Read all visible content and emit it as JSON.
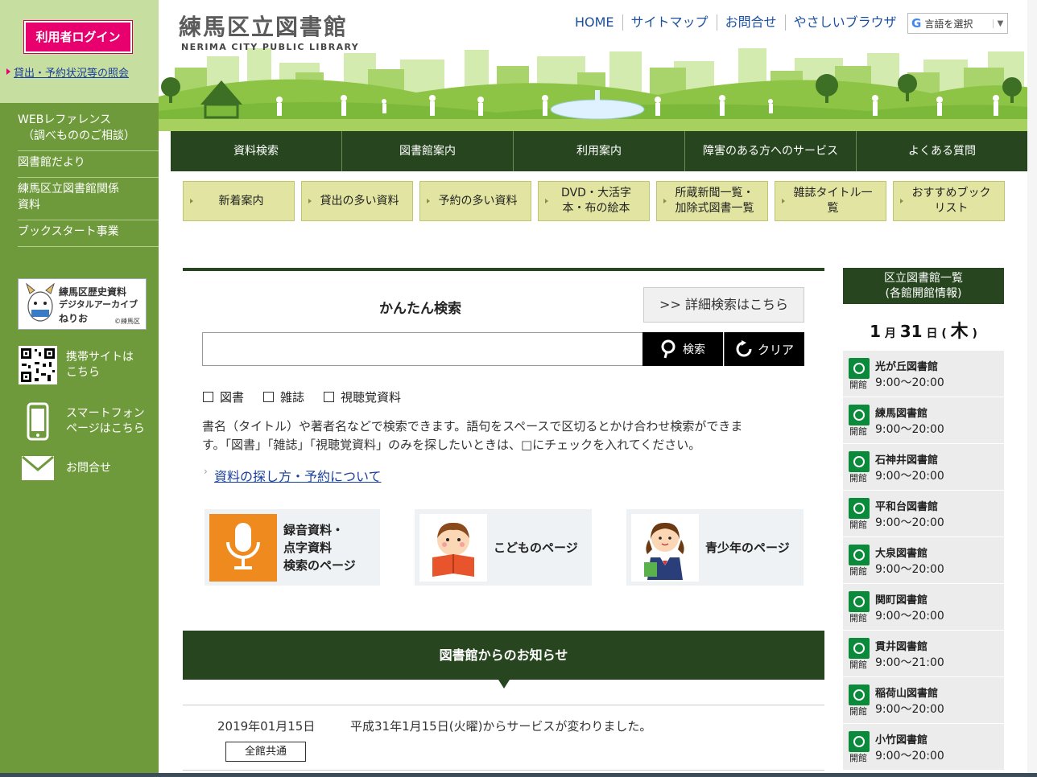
{
  "sidebar": {
    "login_label": "利用者ログイン",
    "lending_link": "貸出・予約状況等の照会",
    "nav": [
      {
        "line1": "WEBレファレンス",
        "line2": "（調べもののご相談）"
      },
      {
        "line1": "図書館だより",
        "line2": ""
      },
      {
        "line1": "練馬区立図書館関係",
        "line2": "資料"
      },
      {
        "line1": "ブックスタート事業",
        "line2": ""
      }
    ],
    "archive": {
      "line1": "練馬区歴史資料",
      "line2": "デジタルアーカイブ",
      "line3": "ねりお",
      "credit": "©練馬区"
    },
    "mobile": {
      "line1": "携帯サイトは",
      "line2": "こちら"
    },
    "smartphone": {
      "line1": "スマートフォン",
      "line2": "ページはこちら"
    },
    "contact": "お問合せ"
  },
  "header": {
    "title": "練馬区立図書館",
    "subtitle": "NERIMA CITY PUBLIC LIBRARY",
    "links": [
      "HOME",
      "サイトマップ",
      "お問合せ",
      "やさしいブラウザ"
    ],
    "lang_select": "言語を選択"
  },
  "main_nav": [
    "資料検索",
    "図書館案内",
    "利用案内",
    "障害のある方へのサービス",
    "よくある質問"
  ],
  "sub_nav": [
    {
      "line1": "新着案内",
      "line2": ""
    },
    {
      "line1": "貸出の多い資料",
      "line2": ""
    },
    {
      "line1": "予約の多い資料",
      "line2": ""
    },
    {
      "line1": "DVD・大活字",
      "line2": "本・布の絵本"
    },
    {
      "line1": "所蔵新聞一覧・",
      "line2": "加除式図書一覧"
    },
    {
      "line1": "雑誌タイトル一",
      "line2": "覧"
    },
    {
      "line1": "おすすめブック",
      "line2": "リスト"
    }
  ],
  "search": {
    "title": "かんたん検索",
    "advanced": ">> 詳細検索はこちら",
    "input_value": "",
    "search_btn": "検索",
    "clear_btn": "クリア",
    "checkboxes": [
      "図書",
      "雑誌",
      "視聴覚資料"
    ],
    "desc1": "書名（タイトル）や著者名などで検索できます。語句をスペースで区切るとかけ合わせ検索ができま",
    "desc2": "す。「図書」「雑誌」「視聴覚資料」のみを探したいときは、□にチェックを入れてください。",
    "howto": "資料の探し方・予約について"
  },
  "features": [
    {
      "line1": "録音資料・",
      "line2": "点字資料",
      "line3": "検索のページ"
    },
    {
      "line1": "こどものページ",
      "line2": "",
      "line3": ""
    },
    {
      "line1": "青少年のページ",
      "line2": "",
      "line3": ""
    }
  ],
  "news": {
    "heading": "図書館からのお知らせ",
    "items": [
      {
        "date": "2019年01月15日",
        "text": "平成31年1月15日(火曜)からサービスが変わりました。",
        "tag": "全館共通"
      }
    ]
  },
  "libraries": {
    "heading1": "区立図書館一覧",
    "heading2": "(各館開館情報)",
    "date": {
      "month": "1",
      "month_suffix": "月",
      "day": "31",
      "day_suffix": "日",
      "open_paren": "(",
      "weekday": "木",
      "close_paren": ")"
    },
    "list": [
      {
        "name": "光が丘図書館",
        "hours": "9:00～20:00",
        "status": "開館"
      },
      {
        "name": "練馬図書館",
        "hours": "9:00～20:00",
        "status": "開館"
      },
      {
        "name": "石神井図書館",
        "hours": "9:00～20:00",
        "status": "開館"
      },
      {
        "name": "平和台図書館",
        "hours": "9:00～20:00",
        "status": "開館"
      },
      {
        "name": "大泉図書館",
        "hours": "9:00～20:00",
        "status": "開館"
      },
      {
        "name": "関町図書館",
        "hours": "9:00～20:00",
        "status": "開館"
      },
      {
        "name": "貫井図書館",
        "hours": "9:00～21:00",
        "status": "開館"
      },
      {
        "name": "稲荷山図書館",
        "hours": "9:00～20:00",
        "status": "開館"
      },
      {
        "name": "小竹図書館",
        "hours": "9:00～20:00",
        "status": "開館"
      }
    ]
  },
  "colors": {
    "dark_green": "#27461f",
    "sidebar_green": "#6f9a3b",
    "login_pink": "#e8006e",
    "sub_button": "#e2e5a1",
    "open_mark": "#0a8a3a"
  }
}
